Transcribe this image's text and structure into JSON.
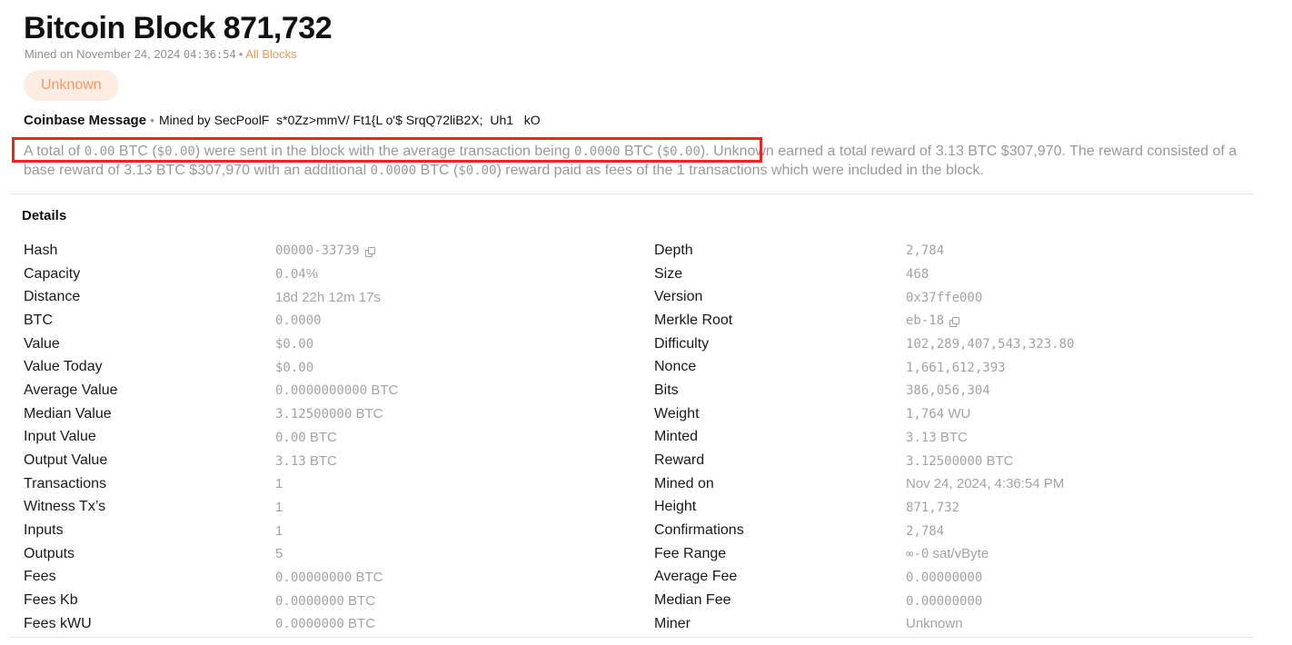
{
  "header": {
    "title_prefix": "Bitcoin Block",
    "block_number": "871,732",
    "mined_on_label": "Mined on November 24, 2024",
    "mined_time": "04:36:54",
    "separator": "•",
    "all_blocks_link": "All Blocks"
  },
  "miner_badge": "Unknown",
  "coinbase": {
    "label": "Coinbase Message",
    "separator": "•",
    "message": "Mined by SecPoolF  s*0Zz>mmV/ Ft1{L o'$ SrqQ72liB2X;  Uh1   kO"
  },
  "summary": {
    "t1": "A total of ",
    "total_btc": "0.00",
    "t2": " BTC (",
    "total_usd": "$0.00",
    "t3": ") were sent in the block with the average transaction being ",
    "avg_btc": "0.0000",
    "t4": " BTC (",
    "avg_usd": "$0.00",
    "t5": "). Unknown earned a total reward of 3.13 BTC $307,970. The reward consisted of a base reward of 3.13 BTC $307,970 with an additional ",
    "fee_btc": "0.0000",
    "t6": " BTC (",
    "fee_usd": "$0.00",
    "t7": ") reward paid as fees of the 1 transactions which were included in the block."
  },
  "details": {
    "title": "Details",
    "left": [
      {
        "key": "Hash",
        "value": "00000-33739",
        "mono": "00000-33739",
        "unit": "",
        "copy": true
      },
      {
        "key": "Capacity",
        "value": "0.04%",
        "mono": "0.04",
        "unit": "%",
        "copy": false
      },
      {
        "key": "Distance",
        "value": "18d 22h 12m 17s",
        "mono": "",
        "unit": "18d 22h 12m 17s",
        "copy": false
      },
      {
        "key": "BTC",
        "value": "0.0000",
        "mono": "0.0000",
        "unit": "",
        "copy": false
      },
      {
        "key": "Value",
        "value": "$0.00",
        "mono": "$0.00",
        "unit": "",
        "copy": false
      },
      {
        "key": "Value Today",
        "value": "$0.00",
        "mono": "$0.00",
        "unit": "",
        "copy": false
      },
      {
        "key": "Average Value",
        "value": "0.0000000000 BTC",
        "mono": "0.0000000000",
        "unit": " BTC",
        "copy": false
      },
      {
        "key": "Median Value",
        "value": "3.12500000 BTC",
        "mono": "3.12500000",
        "unit": " BTC",
        "copy": false
      },
      {
        "key": "Input Value",
        "value": "0.00 BTC",
        "mono": "0.00",
        "unit": " BTC",
        "copy": false
      },
      {
        "key": "Output Value",
        "value": "3.13 BTC",
        "mono": "3.13",
        "unit": " BTC",
        "copy": false
      },
      {
        "key": "Transactions",
        "value": "1",
        "mono": "",
        "unit": "1",
        "copy": false
      },
      {
        "key": "Witness Tx’s",
        "value": "1",
        "mono": "",
        "unit": "1",
        "copy": false
      },
      {
        "key": "Inputs",
        "value": "1",
        "mono": "",
        "unit": "1",
        "copy": false
      },
      {
        "key": "Outputs",
        "value": "5",
        "mono": "",
        "unit": "5",
        "copy": false
      },
      {
        "key": "Fees",
        "value": "0.00000000 BTC",
        "mono": "0.00000000",
        "unit": " BTC",
        "copy": false
      },
      {
        "key": "Fees Kb",
        "value": "0.0000000 BTC",
        "mono": "0.0000000",
        "unit": " BTC",
        "copy": false
      },
      {
        "key": "Fees kWU",
        "value": "0.0000000 BTC",
        "mono": "0.0000000",
        "unit": " BTC",
        "copy": false
      }
    ],
    "right": [
      {
        "key": "Depth",
        "value": "2,784",
        "mono": "2,784",
        "unit": "",
        "copy": false
      },
      {
        "key": "Size",
        "value": "468",
        "mono": "468",
        "unit": "",
        "copy": false
      },
      {
        "key": "Version",
        "value": "0x37ffe000",
        "mono": "0x37ffe000",
        "unit": "",
        "copy": false
      },
      {
        "key": "Merkle Root",
        "value": "eb-18",
        "mono": "eb-18",
        "unit": "",
        "copy": true
      },
      {
        "key": "Difficulty",
        "value": "102,289,407,543,323.80",
        "mono": "102,289,407,543,323.80",
        "unit": "",
        "copy": false
      },
      {
        "key": "Nonce",
        "value": "1,661,612,393",
        "mono": "1,661,612,393",
        "unit": "",
        "copy": false
      },
      {
        "key": "Bits",
        "value": "386,056,304",
        "mono": "386,056,304",
        "unit": "",
        "copy": false
      },
      {
        "key": "Weight",
        "value": "1,764 WU",
        "mono": "1,764",
        "unit": " WU",
        "copy": false
      },
      {
        "key": "Minted",
        "value": "3.13 BTC",
        "mono": "3.13",
        "unit": " BTC",
        "copy": false
      },
      {
        "key": "Reward",
        "value": "3.12500000 BTC",
        "mono": "3.12500000",
        "unit": " BTC",
        "copy": false
      },
      {
        "key": "Mined on",
        "value": "Nov 24, 2024, 4:36:54 PM",
        "mono": "",
        "unit": "Nov 24, 2024, 4:36:54 PM",
        "copy": false
      },
      {
        "key": "Height",
        "value": "871,732",
        "mono": "871,732",
        "unit": "",
        "copy": false
      },
      {
        "key": "Confirmations",
        "value": "2,784",
        "mono": "2,784",
        "unit": "",
        "copy": false
      },
      {
        "key": "Fee Range",
        "value": "∞-0 sat/vByte",
        "mono": "∞-0",
        "unit": " sat/vByte",
        "copy": false
      },
      {
        "key": "Average Fee",
        "value": "0.00000000",
        "mono": "0.00000000",
        "unit": "",
        "copy": false
      },
      {
        "key": "Median Fee",
        "value": "0.00000000",
        "mono": "0.00000000",
        "unit": "",
        "copy": false
      },
      {
        "key": "Miner",
        "value": "Unknown",
        "mono": "",
        "unit": "Unknown",
        "copy": false
      }
    ]
  },
  "colors": {
    "accent": "#ee9a5e",
    "badge_bg": "#fdece1",
    "highlight_border": "#e8271e",
    "muted_text": "#a3a3a3"
  }
}
